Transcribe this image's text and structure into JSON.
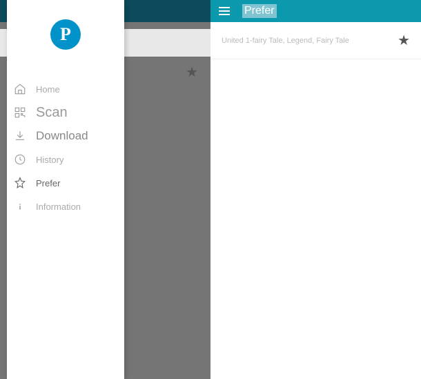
{
  "logo_letter": "P",
  "sidebar": {
    "items": [
      {
        "label": "Home"
      },
      {
        "label": "Scan"
      },
      {
        "label": "Download"
      },
      {
        "label": "History"
      },
      {
        "label": "Prefer"
      },
      {
        "label": "Information"
      }
    ]
  },
  "right": {
    "title": "Prefer",
    "list": [
      {
        "text": "United 1-fairy Tale, Legend, Fairy Tale"
      }
    ]
  }
}
